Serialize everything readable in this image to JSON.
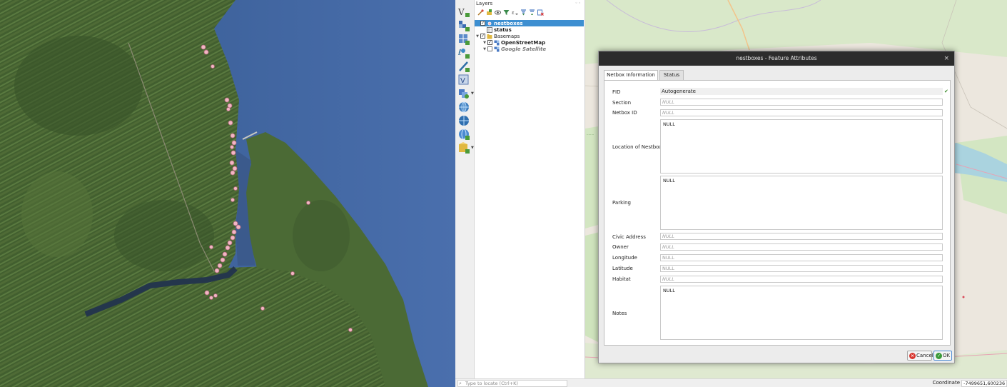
{
  "layers_panel": {
    "title": "Layers",
    "close_glyph": "◦◦",
    "toolbar_icons": [
      "style-manager-icon",
      "add-group-icon",
      "visibility-icon",
      "filter-legend-icon",
      "expression-filter-icon",
      "expand-all-icon",
      "collapse-all-icon",
      "remove-layer-icon"
    ],
    "layers": [
      {
        "name": "nestboxes",
        "checked": true,
        "selected": true,
        "icon": "point-layer-icon"
      },
      {
        "name": "status",
        "checked": false,
        "selected": false,
        "icon": "table-layer-icon"
      },
      {
        "name": "Basemaps",
        "checked": true,
        "group": true,
        "icon": "group-icon"
      },
      {
        "name": "OpenStreetMap",
        "checked": true,
        "icon": "xyz-tile-icon"
      },
      {
        "name": "Google Satellite",
        "checked": false,
        "icon": "xyz-tile-icon"
      }
    ]
  },
  "left_toolbar_icons": [
    "add-vector-layer-icon",
    "add-raster-layer-icon",
    "add-mesh-layer-icon",
    "add-delimited-text-icon",
    "add-spatialite-icon",
    "add-virtual-layer-icon",
    "add-wms-icon",
    "add-wfs-icon",
    "add-wcs-icon",
    "add-xyz-icon",
    "new-shapefile-icon"
  ],
  "status_bar": {
    "locator_placeholder": "Type to locate (Ctrl+K)",
    "coordinate_label": "Coordinate",
    "coordinate_value": "-7499651,600236"
  },
  "dialog": {
    "title": "nestboxes - Feature Attributes",
    "close_glyph": "×",
    "tabs": [
      "Netbox Information",
      "Status"
    ],
    "active_tab": 0,
    "fields": [
      {
        "label": "FID",
        "value": "Autogenerate",
        "kind": "fid"
      },
      {
        "label": "Section",
        "value": "NULL",
        "kind": "null"
      },
      {
        "label": "Netbox ID",
        "value": "NULL",
        "kind": "null"
      },
      {
        "label": "Location of Nestbox",
        "value": "NULL",
        "kind": "area"
      },
      {
        "label": "Parking",
        "value": "NULL",
        "kind": "area"
      },
      {
        "label": "Civic Address",
        "value": "NULL",
        "kind": "null"
      },
      {
        "label": "Owner",
        "value": "NULL",
        "kind": "null"
      },
      {
        "label": "Longitude",
        "value": "NULL",
        "kind": "plainnull"
      },
      {
        "label": "Latitude",
        "value": "NULL",
        "kind": "plainnull"
      },
      {
        "label": "Habitat",
        "value": "NULL",
        "kind": "null"
      },
      {
        "label": "Notes",
        "value": "NULL",
        "kind": "area"
      }
    ],
    "fid_check": "✔",
    "cancel_label": "Cancel",
    "ok_label": "OK"
  },
  "colors": {
    "selection_blue": "#3d8fd1",
    "titlebar": "#2c2c2c",
    "water": "#3b5e96",
    "marker_pink": "#f2b6c4"
  }
}
